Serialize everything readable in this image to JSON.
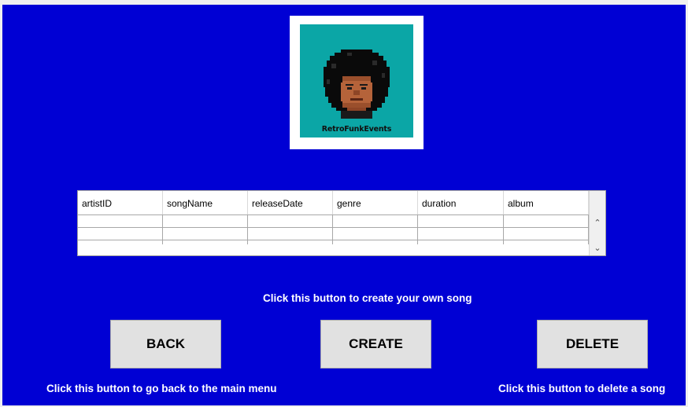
{
  "colors": {
    "panel_bg": "#0000D4",
    "hint_text": "#FFFFFF",
    "button_bg": "#E1E1E1",
    "logo_bg": "#0BA6A6"
  },
  "logo": {
    "icon": "afro-portrait-icon",
    "caption": "RetroFunkEvents"
  },
  "table": {
    "columns": [
      "artistID",
      "songName",
      "releaseDate",
      "genre",
      "duration",
      "album"
    ],
    "rows": [
      [
        "",
        "",
        "",
        "",
        "",
        ""
      ],
      [
        "",
        "",
        "",
        "",
        "",
        ""
      ],
      [
        "",
        "",
        "",
        "",
        "",
        ""
      ]
    ],
    "scroll_up_icon": "chevron-up-icon",
    "scroll_down_icon": "chevron-down-icon"
  },
  "hints": {
    "create": "Click this button to create your own song",
    "back": "Click this button to go back to the main menu",
    "delete": "Click this button to delete a song"
  },
  "buttons": {
    "back": "BACK",
    "create": "CREATE",
    "delete": "DELETE"
  }
}
